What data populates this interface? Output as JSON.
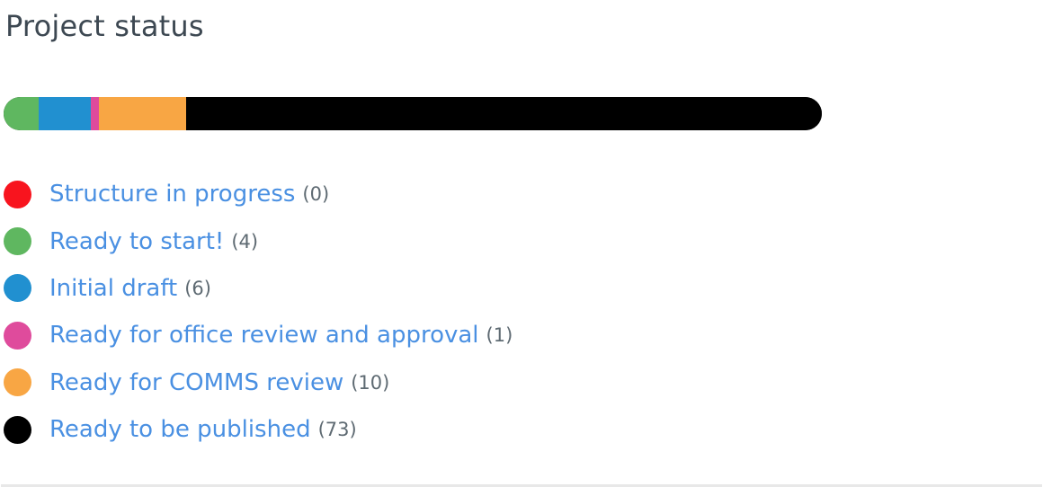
{
  "title": "Project status",
  "chart_data": {
    "type": "bar",
    "orientation": "horizontal-stacked",
    "title": "Project status",
    "categories": [
      "Structure in progress",
      "Ready to start!",
      "Initial draft",
      "Ready for office review and approval",
      "Ready for COMMS review",
      "Ready to be published"
    ],
    "values": [
      0,
      4,
      6,
      1,
      10,
      73
    ],
    "colors": [
      "#f8141e",
      "#5fb760",
      "#2190d0",
      "#df4b9c",
      "#f8a644",
      "#000000"
    ],
    "total": 94,
    "legend_placement": "bottom"
  },
  "legend": [
    {
      "label": "Structure in progress",
      "count": "(0)"
    },
    {
      "label": "Ready to start!",
      "count": "(4)"
    },
    {
      "label": "Initial draft",
      "count": "(6)"
    },
    {
      "label": "Ready for office review and approval",
      "count": "(1)"
    },
    {
      "label": "Ready for COMMS review",
      "count": "(10)"
    },
    {
      "label": "Ready to be published",
      "count": "(73)"
    }
  ]
}
